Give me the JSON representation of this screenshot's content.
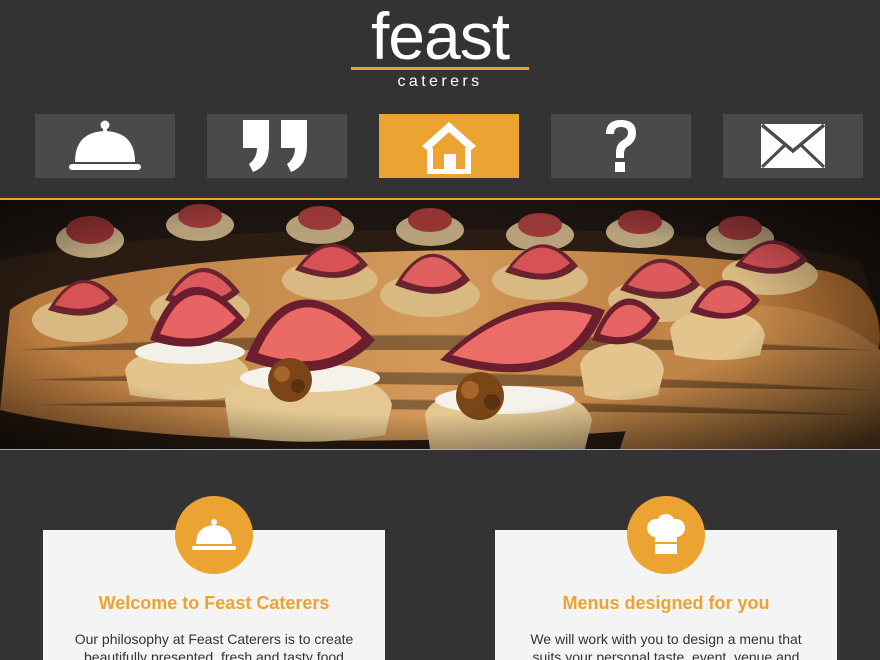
{
  "brand": {
    "name": "feast",
    "tagline": "caterers",
    "accent_color": "#eba432",
    "background_color": "#333333"
  },
  "nav": {
    "items": [
      {
        "icon": "cloche-icon",
        "active": false
      },
      {
        "icon": "quote-icon",
        "active": false
      },
      {
        "icon": "home-icon",
        "active": true
      },
      {
        "icon": "question-icon",
        "active": false
      },
      {
        "icon": "envelope-icon",
        "active": false
      }
    ]
  },
  "hero": {
    "image_subject": "fig and walnut crostini on wooden board"
  },
  "features": [
    {
      "icon": "cloche-icon",
      "title": "Welcome to Feast Caterers",
      "text": "Our philosophy at Feast Caterers is to create beautifully presented, fresh and tasty food"
    },
    {
      "icon": "chef-hat-icon",
      "title": "Menus designed for you",
      "text": "We will work with you to design a menu that suits your personal taste, event, venue and budget"
    }
  ]
}
